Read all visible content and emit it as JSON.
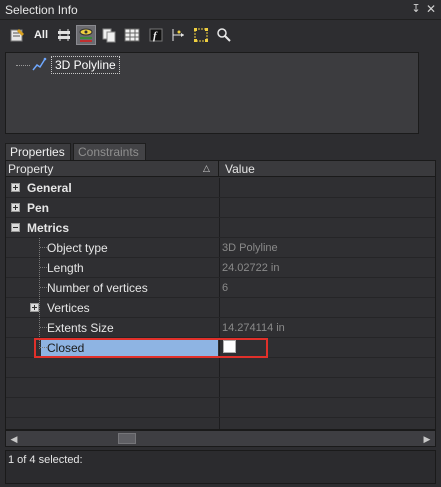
{
  "window": {
    "title": "Selection Info"
  },
  "toolbar": {
    "buttons": [
      {
        "icon": "properties-icon"
      },
      {
        "icon": "all-icon",
        "label": "All"
      },
      {
        "icon": "filter-icon"
      },
      {
        "icon": "layers-eye-icon",
        "active": true
      },
      {
        "icon": "copy-icon"
      },
      {
        "icon": "table-icon"
      },
      {
        "icon": "function-icon"
      },
      {
        "icon": "move-axis-icon"
      },
      {
        "icon": "select-box-icon"
      },
      {
        "icon": "zoom-search-icon"
      }
    ]
  },
  "tree": {
    "item_label": "3D Polyline"
  },
  "tabs": [
    {
      "label": "Properties",
      "active": true
    },
    {
      "label": "Constraints",
      "active": false
    }
  ],
  "grid": {
    "headers": {
      "property": "Property",
      "value": "Value"
    },
    "groups": {
      "general": "General",
      "pen": "Pen",
      "metrics": "Metrics"
    },
    "metrics": {
      "object_type": {
        "label": "Object type",
        "value": "3D Polyline"
      },
      "length": {
        "label": "Length",
        "value": "24.02722 in"
      },
      "num_vertices": {
        "label": "Number of vertices",
        "value": "6"
      },
      "vertices": {
        "label": "Vertices"
      },
      "extents_size": {
        "label": "Extents Size",
        "value": "14.274114 in"
      },
      "closed": {
        "label": "Closed",
        "checked": false
      }
    }
  },
  "status": {
    "text": "1 of 4 selected:"
  },
  "colors": {
    "background": "#2d2d30",
    "selection": "#8eb4e3",
    "highlight_border": "#e0302a"
  }
}
